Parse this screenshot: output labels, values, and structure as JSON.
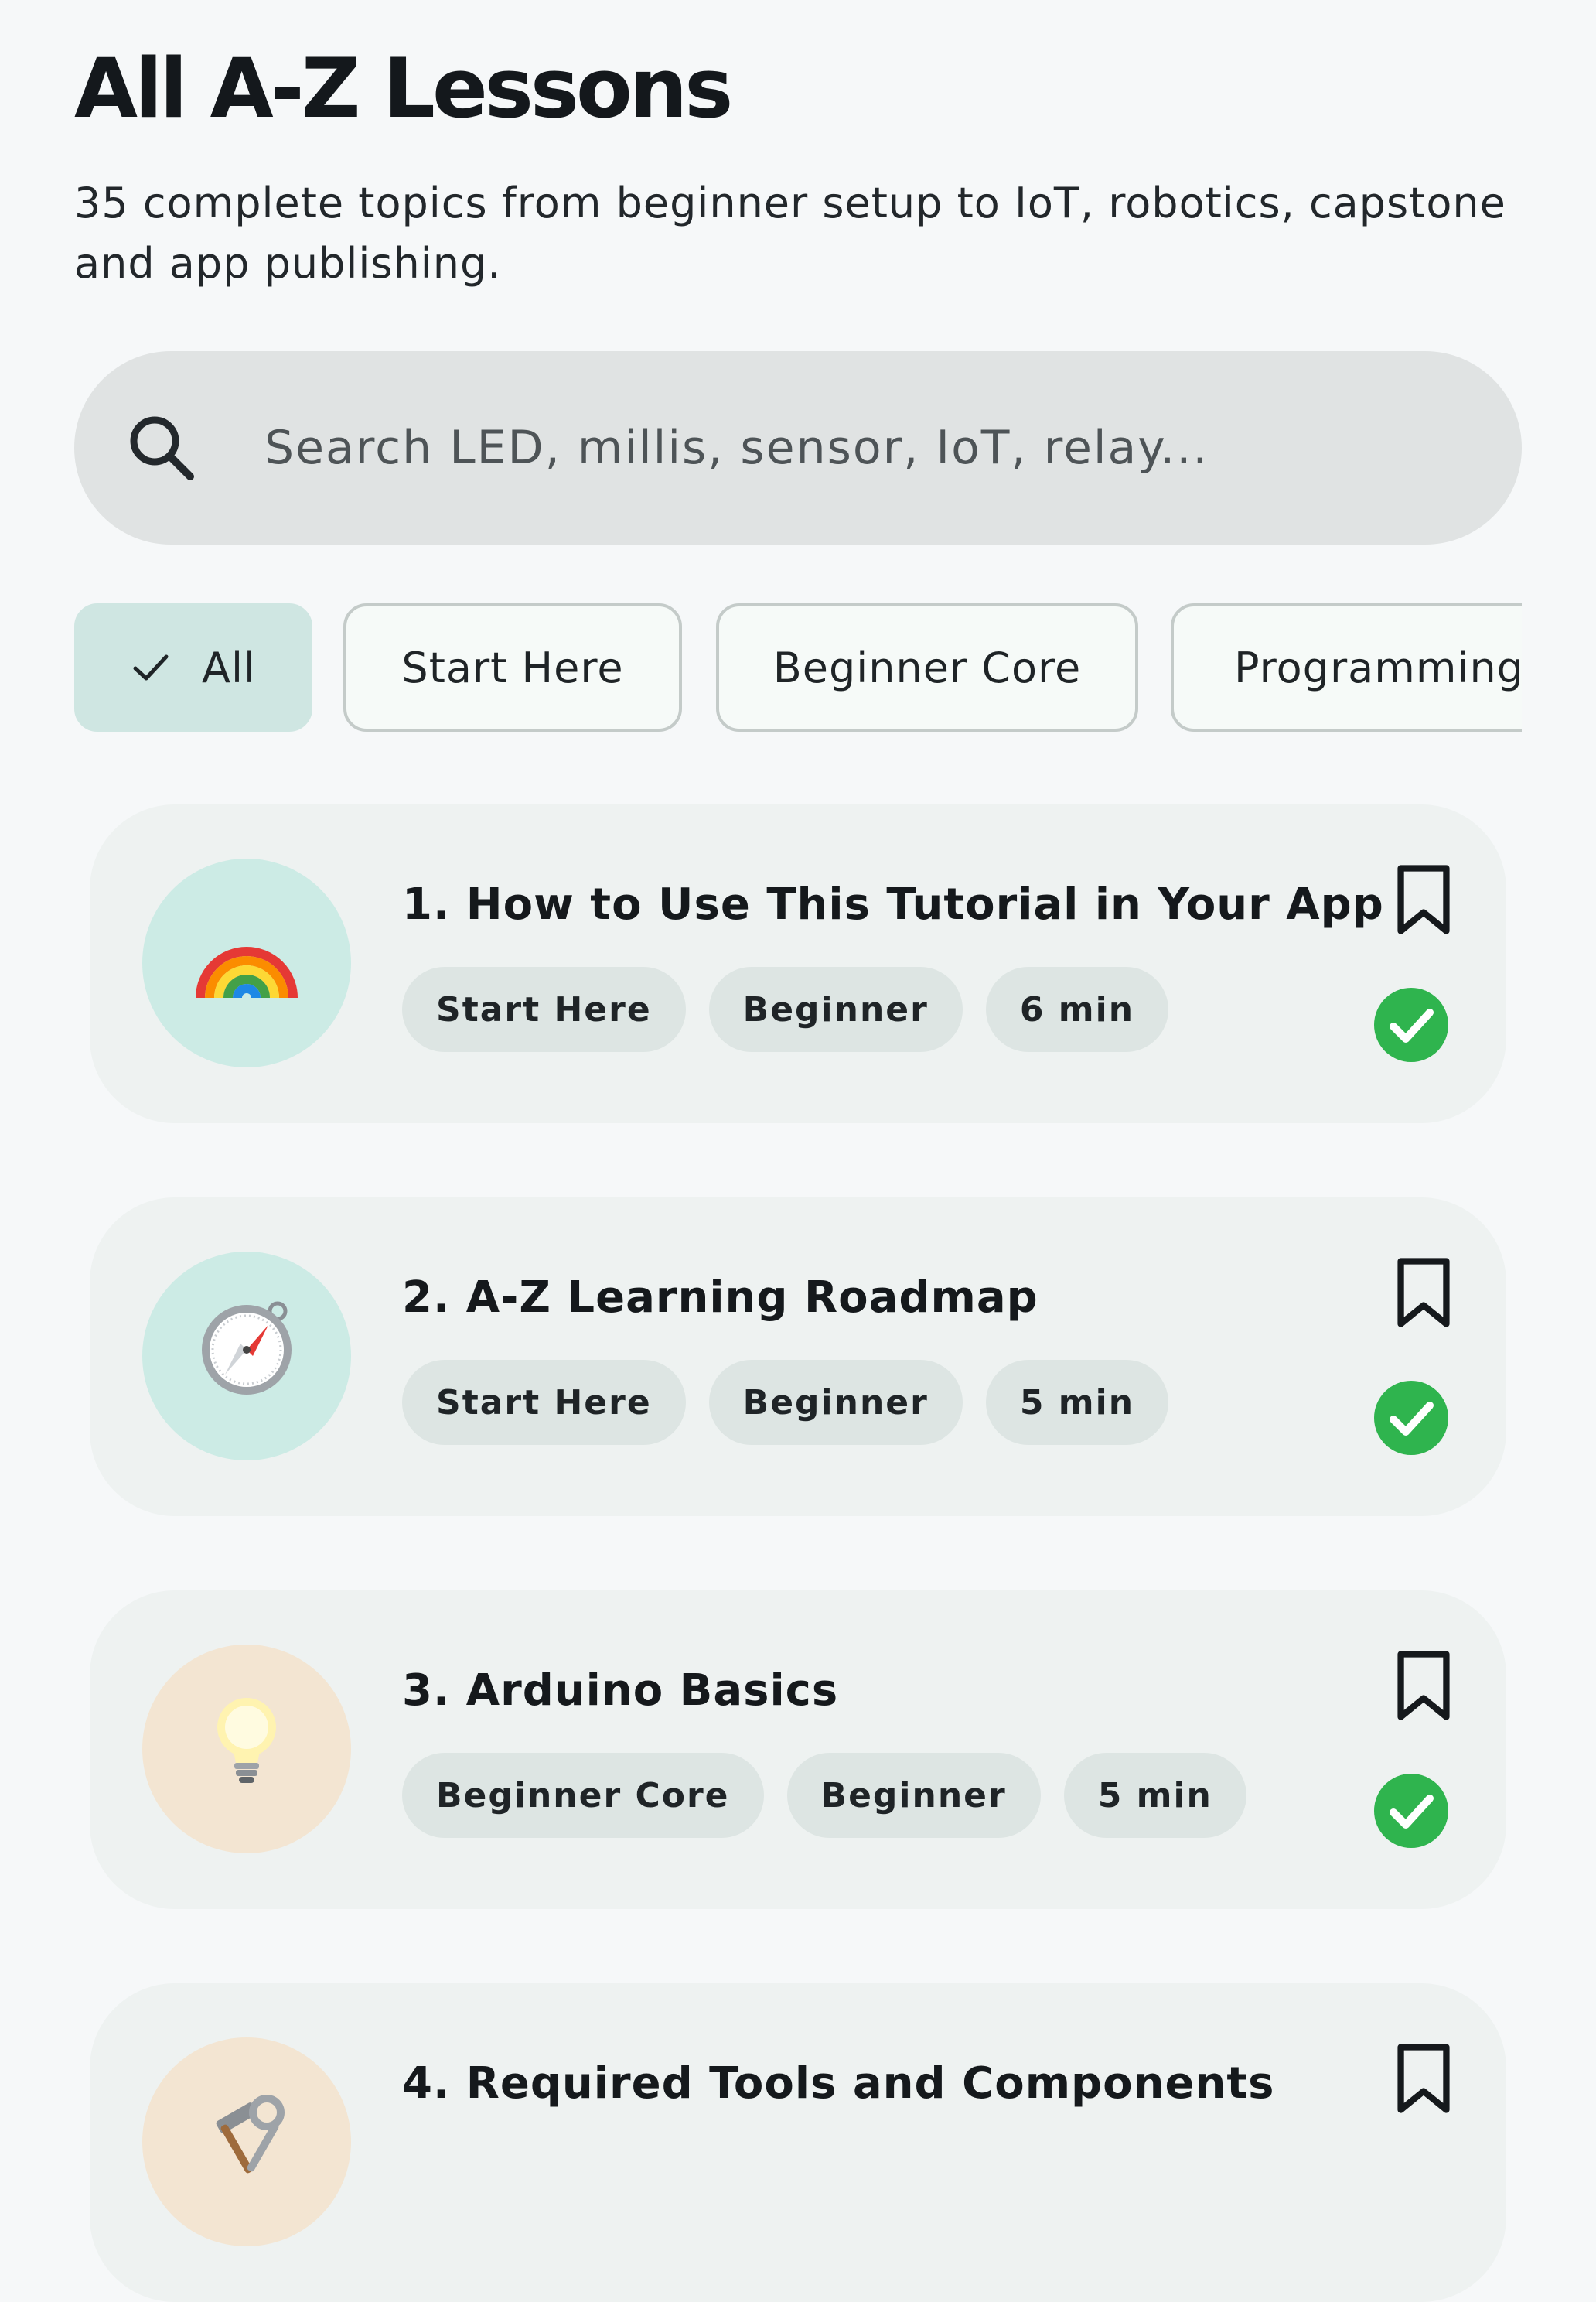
{
  "page": {
    "title": "All A-Z Lessons",
    "subtitle": "35 complete topics from beginner setup to IoT, robotics, capstone and app publishing."
  },
  "search": {
    "placeholder": "Search LED, millis, sensor, IoT, relay...",
    "icon": "search-icon"
  },
  "filters": {
    "selected": "All",
    "items": [
      {
        "label": "All",
        "selected": true
      },
      {
        "label": "Start Here",
        "selected": false
      },
      {
        "label": "Beginner Core",
        "selected": false
      },
      {
        "label": "Programming",
        "selected": false
      }
    ]
  },
  "colors": {
    "accent_chip": "#cfe6e2",
    "done_green": "#2fb44e",
    "avatar_teal": "#ccebe5",
    "avatar_peach": "#f3e5d2"
  },
  "lessons": [
    {
      "title": "1. How to Use This Tutorial in Your App",
      "icon": "rainbow-icon",
      "tags": [
        "Start Here",
        "Beginner",
        "6 min"
      ],
      "completed": true,
      "bookmarked": false
    },
    {
      "title": "2. A-Z Learning Roadmap",
      "icon": "compass-icon",
      "tags": [
        "Start Here",
        "Beginner",
        "5 min"
      ],
      "completed": true,
      "bookmarked": false
    },
    {
      "title": "3. Arduino Basics",
      "icon": "lightbulb-icon",
      "tags": [
        "Beginner Core",
        "Beginner",
        "5 min"
      ],
      "completed": true,
      "bookmarked": false
    },
    {
      "title": "4. Required Tools and Components",
      "icon": "hammer-wrench-icon",
      "tags": [],
      "completed": false,
      "bookmarked": false
    }
  ]
}
